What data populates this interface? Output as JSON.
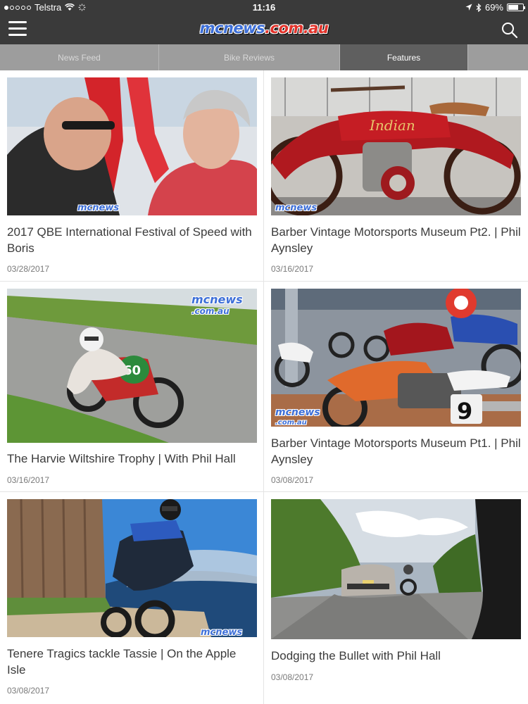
{
  "status_bar": {
    "carrier": "Telstra",
    "time": "11:16",
    "battery": "69%",
    "battery_level": 0.69
  },
  "header": {
    "logo_prefix": "mcnews",
    "logo_domain": ".com.au"
  },
  "tabs": [
    {
      "label": "News Feed"
    },
    {
      "label": "Bike Reviews"
    },
    {
      "label": "Features"
    }
  ],
  "active_tab": "Features",
  "watermarks": {
    "w1": "mcnews",
    "w3": "mcnews",
    "w3b": ".com.au",
    "w4": "mcnews",
    "w4b": ".com.au"
  },
  "articles": [
    {
      "title": "2017 QBE International Festival of Speed with Boris",
      "date": "03/28/2017"
    },
    {
      "title": "Barber Vintage Motorsports Museum Pt2. | Phil Aynsley",
      "date": "03/16/2017"
    },
    {
      "title": "The Harvie Wiltshire Trophy | With Phil Hall",
      "date": "03/16/2017"
    },
    {
      "title": "Barber Vintage Motorsports Museum Pt1. | Phil Aynsley",
      "date": "03/08/2017"
    },
    {
      "title": "Tenere Tragics tackle Tassie | On the Apple Isle",
      "date": "03/08/2017"
    },
    {
      "title": "Dodging the Bullet with Phil Hall",
      "date": "03/08/2017"
    }
  ]
}
